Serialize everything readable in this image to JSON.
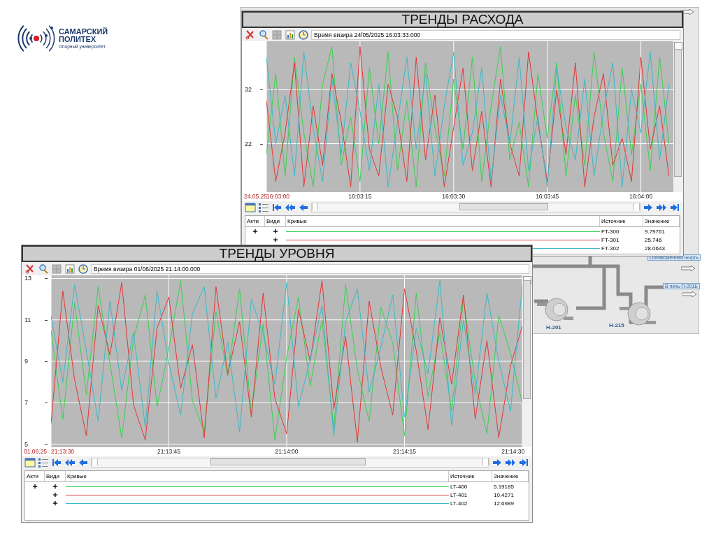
{
  "logo": {
    "name_line1": "САМАРСКИЙ",
    "name_line2": "ПОЛИТЕХ",
    "tagline": "Опорный университет"
  },
  "scheme": {
    "labels": [
      "Обезвоженная нефть",
      "В печь П-201Б"
    ],
    "pumps": [
      "Н-201",
      "Н-215"
    ]
  },
  "windows": [
    {
      "title": "ТРЕНДЫ РАСХОДА",
      "cursor_time": "Время визира 24/05/2025 16:03:33.000",
      "date": "24.05.25",
      "chart_data": {
        "type": "line",
        "x": [
          57780,
          57781.5,
          57783,
          57784.5,
          57786,
          57787.5,
          57789,
          57790.5,
          57792,
          57793.5,
          57795,
          57796.5,
          57798,
          57799.5,
          57801,
          57802.5,
          57804,
          57805.5,
          57807,
          57808.5,
          57810,
          57811.5,
          57813,
          57814.5,
          57816,
          57817.5,
          57819,
          57820.5,
          57822,
          57823.5,
          57825,
          57826.5,
          57828,
          57829.5,
          57831,
          57832.5,
          57834,
          57835.5,
          57837,
          57838.5,
          57840,
          57841.5,
          57843,
          57844.5
        ],
        "xlim": [
          57780,
          57845.2
        ],
        "ylim": [
          13,
          41
        ],
        "grid": true,
        "yticks": [
          {
            "value": 32,
            "label": "32"
          },
          {
            "value": 22,
            "label": "22"
          }
        ],
        "xticks": [
          {
            "value": 57780,
            "label": "16:03:00"
          },
          {
            "value": 57795,
            "label": "16:03:15"
          },
          {
            "value": 57810,
            "label": "16:03:30"
          },
          {
            "value": 57825,
            "label": "16:03:45"
          },
          {
            "value": 57840,
            "label": "16:04:00"
          }
        ],
        "series": [
          {
            "color": "#3ccf50",
            "values": [
              20,
              35,
              16,
              38,
              24,
              14,
              33,
              40,
              18,
              27,
              15,
              36,
              22,
              39,
              17,
              30,
              14,
              37,
              25,
              16,
              34,
              21,
              38,
              15,
              29,
              40,
              19,
              26,
              14,
              35,
              23,
              37,
              16,
              31,
              18,
              39,
              24,
              15,
              36,
              20,
              33,
              17,
              38,
              22
            ]
          },
          {
            "color": "#e03838",
            "values": [
              30,
              15,
              24,
              37,
              14,
              29,
              18,
              35,
              26,
              14,
              40,
              21,
              16,
              33,
              27,
              15,
              38,
              19,
              31,
              14,
              25,
              36,
              17,
              28,
              14,
              34,
              22,
              16,
              39,
              26,
              15,
              32,
              20,
              37,
              14,
              27,
              35,
              18,
              23,
              15,
              38,
              21,
              29,
              16
            ]
          },
          {
            "color": "#3cb8c8",
            "values": [
              38,
              22,
              31,
              16,
              39,
              25,
              15,
              34,
              20,
              37,
              28,
              17,
              33,
              14,
              26,
              38,
              21,
              35,
              16,
              29,
              39,
              18,
              24,
              36,
              15,
              31,
              22,
              38,
              17,
              27,
              14,
              36,
              25,
              19,
              34,
              16,
              28,
              37,
              14,
              32,
              24,
              39,
              19,
              33
            ]
          }
        ]
      },
      "columns": [
        "Акти",
        "Види",
        "Кривые",
        "Источник",
        "Значение"
      ],
      "rows": [
        {
          "active": true,
          "visible": true,
          "color": "#3ccf50",
          "source": "FT-300",
          "value": "9.79761"
        },
        {
          "active": false,
          "visible": true,
          "color": "#e03838",
          "source": "FT-301",
          "value": "25.746"
        },
        {
          "color": "#3cb8c8",
          "source": "FT-302",
          "value": "28.0643"
        }
      ]
    },
    {
      "title": "ТРЕНДЫ УРОВНЯ",
      "cursor_time": "Время визира 01/06/2025 21:14:00.000",
      "date": "01.06.25",
      "chart_data": {
        "type": "line",
        "x": [
          76410,
          76411.5,
          76413,
          76414.5,
          76416,
          76417.5,
          76419,
          76420.5,
          76422,
          76423.5,
          76425,
          76426.5,
          76428,
          76429.5,
          76431,
          76432.5,
          76434,
          76435.5,
          76437,
          76438.5,
          76440,
          76441.5,
          76443,
          76444.5,
          76446,
          76447.5,
          76449,
          76450.5,
          76452,
          76453.5,
          76455,
          76456.5,
          76458,
          76459.5,
          76461,
          76462.5,
          76464,
          76465.5,
          76467,
          76468.5,
          76470
        ],
        "xlim": [
          76410,
          76470
        ],
        "ylim": [
          4.85,
          13.15
        ],
        "grid": true,
        "yticks": [
          {
            "value": 13,
            "label": "13"
          },
          {
            "value": 11,
            "label": "11"
          },
          {
            "value": 9,
            "label": "9"
          },
          {
            "value": 7,
            "label": "7"
          },
          {
            "value": 5,
            "label": "5"
          }
        ],
        "xticks": [
          {
            "value": 76410,
            "label": "21:13:30"
          },
          {
            "value": 76425,
            "label": "21:13:45"
          },
          {
            "value": 76440,
            "label": "21:14:00"
          },
          {
            "value": 76455,
            "label": "21:14:15"
          },
          {
            "value": 76470,
            "label": "21:14:30"
          }
        ],
        "series": [
          {
            "color": "#3ccf50",
            "values": [
              10.5,
              6.2,
              11.8,
              7.4,
              12.6,
              8.9,
              5.3,
              10.1,
              12.2,
              6.8,
              9.6,
              12.9,
              7.1,
              5.6,
              11.4,
              8.3,
              12.5,
              6.5,
              10.8,
              5.2,
              9.2,
              12.1,
              7.8,
              11.0,
              5.8,
              12.7,
              8.6,
              6.1,
              11.6,
              9.9,
              5.4,
              12.3,
              7.3,
              10.4,
              6.6,
              12.0,
              8.0,
              5.5,
              11.2,
              9.4,
              7.0
            ]
          },
          {
            "color": "#e03838",
            "values": [
              6.0,
              12.4,
              8.1,
              5.4,
              11.7,
              9.3,
              12.8,
              6.9,
              5.2,
              10.6,
              12.1,
              7.7,
              9.8,
              5.3,
              12.6,
              8.4,
              10.9,
              6.3,
              12.3,
              7.2,
              5.5,
              11.5,
              9.0,
              12.9,
              6.7,
              10.2,
              5.1,
              11.9,
              8.7,
              6.4,
              12.5,
              9.5,
              5.7,
              11.1,
              7.9,
              12.2,
              6.2,
              10.0,
              5.3,
              8.8,
              10.7
            ]
          },
          {
            "color": "#3cb8c8",
            "values": [
              11.2,
              8.0,
              12.7,
              9.5,
              6.1,
              11.9,
              7.6,
              10.4,
              5.8,
              12.4,
              8.9,
              6.4,
              11.3,
              12.6,
              7.2,
              9.9,
              5.6,
              12.0,
              10.3,
              7.9,
              12.8,
              6.8,
              9.1,
              11.7,
              5.4,
              10.9,
              12.5,
              7.5,
              9.7,
              12.2,
              6.3,
              10.6,
              8.4,
              12.9,
              5.9,
              11.0,
              7.4,
              12.3,
              9.0,
              6.6,
              12.7
            ]
          }
        ]
      },
      "columns": [
        "Акти",
        "Види",
        "Кривые",
        "Источник",
        "Значение"
      ],
      "rows": [
        {
          "active": true,
          "visible": true,
          "color": "#3ccf50",
          "source": "LT-400",
          "value": "5.19185"
        },
        {
          "active": false,
          "visible": true,
          "color": "#e03838",
          "source": "LT-401",
          "value": "10.4271"
        },
        {
          "active": false,
          "visible": true,
          "color": "#3cb8c8",
          "source": "LT-402",
          "value": "12.6989"
        }
      ]
    }
  ]
}
